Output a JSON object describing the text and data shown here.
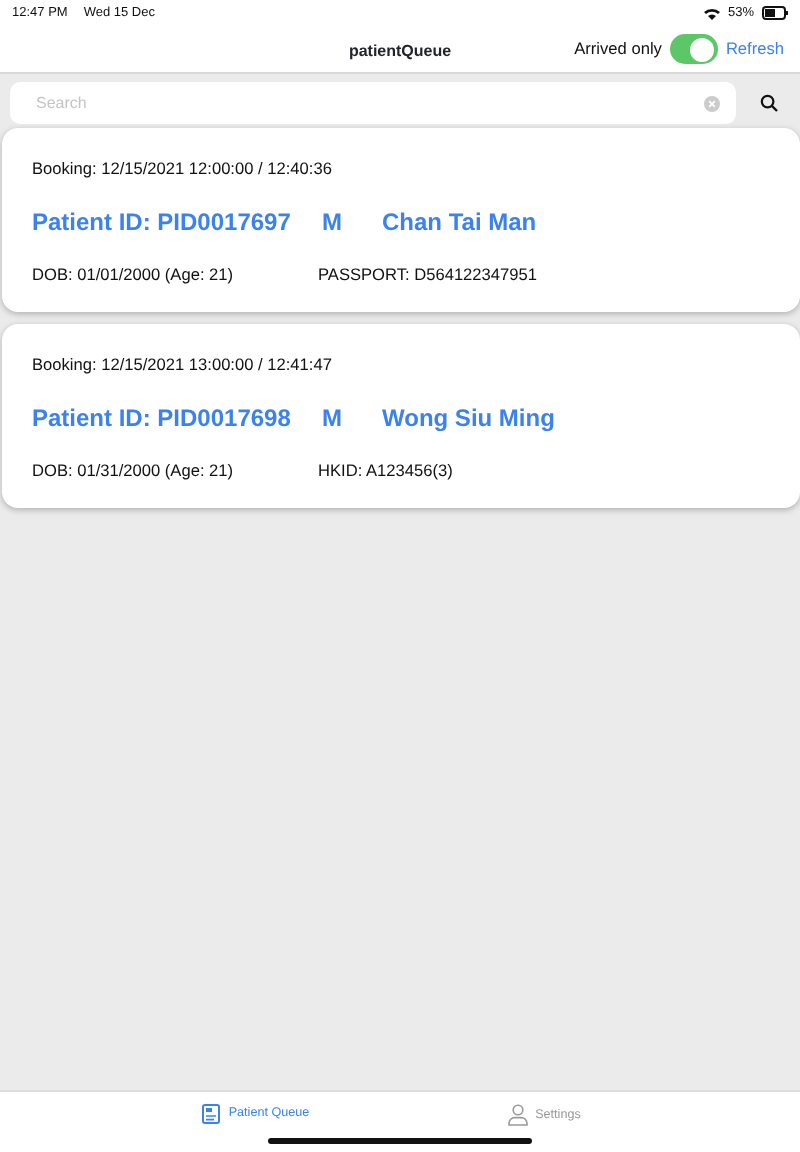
{
  "status_bar": {
    "time": "12:47 PM",
    "date": "Wed 15 Dec",
    "battery": "53%"
  },
  "nav_bar": {
    "title": "patientQueue",
    "toggle_label": "Arrived only",
    "toggle_on": true,
    "action": "Refresh"
  },
  "search": {
    "placeholder": "Search"
  },
  "patients": [
    {
      "booking": "Booking: 12/15/2021 12:00:00 / 12:40:36",
      "patient_id": "Patient ID: PID0017697",
      "sex": "M",
      "name": "Chan Tai Man",
      "dob": "DOB: 01/01/2000 (Age: 21)",
      "document": "PASSPORT: D564122347951"
    },
    {
      "booking": "Booking: 12/15/2021 13:00:00 / 12:41:47",
      "patient_id": "Patient ID: PID0017698",
      "sex": "M",
      "name": "Wong Siu Ming",
      "dob": "DOB: 01/31/2000 (Age: 21)",
      "document": "HKID: A123456(3)"
    }
  ],
  "tab_bar": [
    {
      "label": "Patient Queue",
      "kind": "queue",
      "selected": true
    },
    {
      "label": "Settings",
      "kind": "person",
      "selected": false
    }
  ]
}
